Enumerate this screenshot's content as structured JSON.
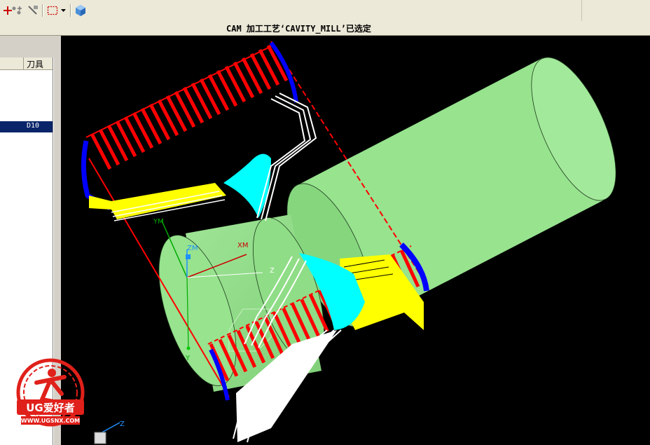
{
  "status": {
    "message": "CAM 加工工艺‘CAVITY_MILL’已选定"
  },
  "navigator": {
    "column_tool": "刀具",
    "selected_tool": "D10"
  },
  "toolbar": {
    "icons": [
      "add-icon",
      "move-icon",
      "tool-icon",
      "select-box-icon",
      "dropdown-arrow-icon",
      "view-cube-icon"
    ]
  },
  "axes": {
    "ym": "YM",
    "zm": "ZM",
    "xm": "XM",
    "z": "Z",
    "y": "Y",
    "triad_z": "Z"
  },
  "watermark": {
    "brand": "UG爱好者",
    "url": "WWW.UGSNX.COM"
  },
  "colors": {
    "part": "#97e38e",
    "cut_path": "#ff0000",
    "engage_path": "#0000ff",
    "rapid_path": "#ffffff",
    "stepover_path": "#ffff00",
    "transfer_path": "#00ffff",
    "toolbar_bg": "#ece9d8",
    "selection": "#0a246a"
  }
}
